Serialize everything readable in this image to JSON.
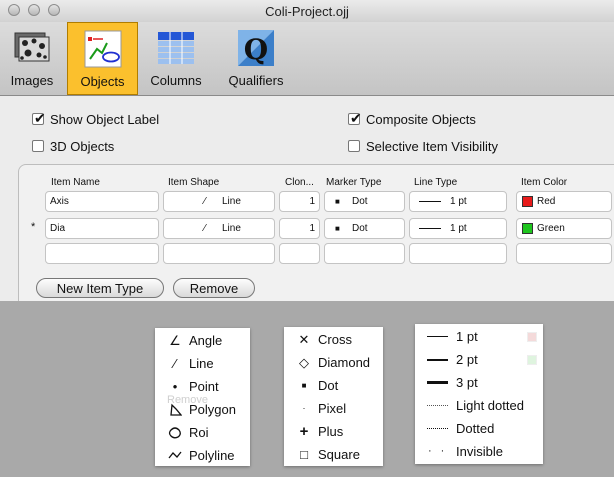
{
  "window": {
    "title": "Coli-Project.ojj"
  },
  "toolbar": {
    "tabs": [
      {
        "label": "Images"
      },
      {
        "label": "Objects"
      },
      {
        "label": "Columns"
      },
      {
        "label": "Qualifiers"
      }
    ]
  },
  "options": {
    "show_object_label": {
      "label": "Show Object Label",
      "checked": true
    },
    "composite_objects": {
      "label": "Composite Objects",
      "checked": true
    },
    "objects_3d": {
      "label": "3D Objects",
      "checked": false
    },
    "selective_item_visibility": {
      "label": "Selective Item Visibility",
      "checked": false
    }
  },
  "table": {
    "headers": [
      "Item Name",
      "Item Shape",
      "Clon...",
      "Marker Type",
      "Line Type",
      "Item Color"
    ],
    "rows": [
      {
        "mark": "",
        "name": "Axis",
        "shape": "Line",
        "clon": "1",
        "marker": "Dot",
        "line": "1 pt",
        "color": "Red",
        "color_hex": "#e81b1b"
      },
      {
        "mark": "*",
        "name": "Dia",
        "shape": "Line",
        "clon": "1",
        "marker": "Dot",
        "line": "1 pt",
        "color": "Green",
        "color_hex": "#1fc61f"
      }
    ]
  },
  "buttons": {
    "new_item_type": "New Item Type",
    "remove": "Remove"
  },
  "shape_menu": {
    "items": [
      {
        "label": "Angle",
        "icon": "angle-icon"
      },
      {
        "label": "Line",
        "icon": "line-icon"
      },
      {
        "label": "Point",
        "icon": "point-icon"
      },
      {
        "label": "Polygon",
        "icon": "polygon-icon"
      },
      {
        "label": "Roi",
        "icon": "roi-icon"
      },
      {
        "label": "Polyline",
        "icon": "polyline-icon"
      }
    ],
    "behind_label": "Remove"
  },
  "marker_menu": {
    "items": [
      {
        "label": "Cross",
        "icon": "cross-icon"
      },
      {
        "label": "Diamond",
        "icon": "diamond-icon"
      },
      {
        "label": "Dot",
        "icon": "dot-icon"
      },
      {
        "label": "Pixel",
        "icon": "pixel-icon"
      },
      {
        "label": "Plus",
        "icon": "plus-icon"
      },
      {
        "label": "Square",
        "icon": "square-icon"
      }
    ]
  },
  "linetype_menu": {
    "items": [
      {
        "label": "1 pt",
        "icon": "line-1pt-icon"
      },
      {
        "label": "2 pt",
        "icon": "line-2pt-icon"
      },
      {
        "label": "3 pt",
        "icon": "line-3pt-icon"
      },
      {
        "label": "Light dotted",
        "icon": "light-dotted-icon"
      },
      {
        "label": "Dotted",
        "icon": "dotted-icon"
      },
      {
        "label": "Invisible",
        "icon": "invisible-icon"
      }
    ]
  }
}
